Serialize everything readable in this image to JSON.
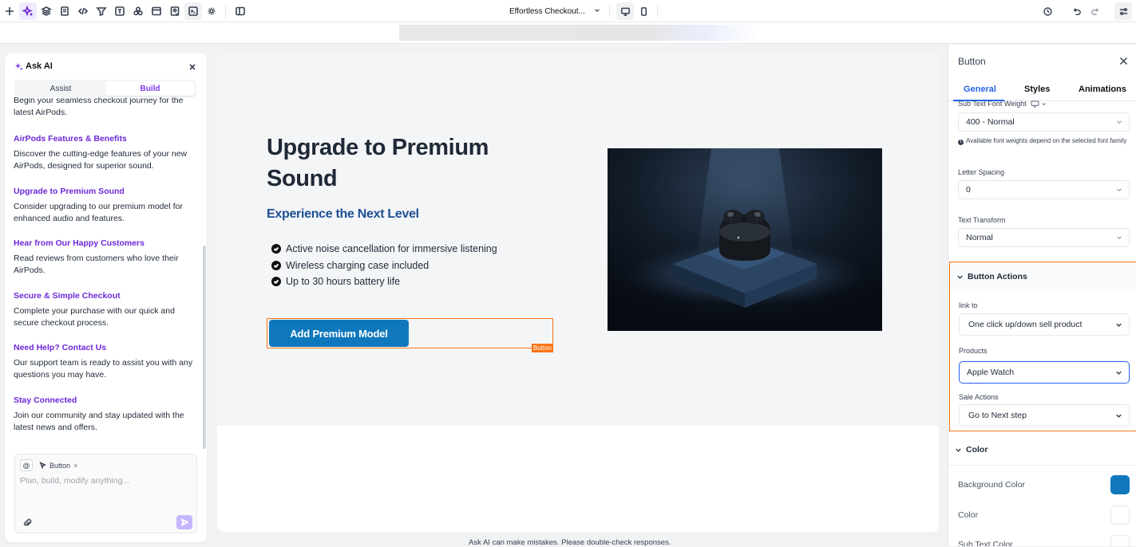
{
  "toolbar": {
    "page_select": "Effortless Checkout...",
    "icons": [
      "plus-icon",
      "ai-sparkle-icon",
      "layers-icon",
      "pages-icon",
      "code-icon",
      "funnel-icon",
      "template-icon",
      "components-icon",
      "layout-icon",
      "media-icon",
      "terminal-icon",
      "settings-cog-icon",
      "sidebar-toggle-icon"
    ]
  },
  "ai_panel": {
    "title": "Ask AI",
    "tabs": {
      "assist": "Assist",
      "build": "Build"
    },
    "clipped_text": "Begin your seamless checkout journey for the latest AirPods.",
    "items": [
      {
        "title": "AirPods Features & Benefits",
        "body": "Discover the cutting-edge features of your new AirPods, designed for superior sound."
      },
      {
        "title": "Upgrade to Premium Sound",
        "body": "Consider upgrading to our premium model for enhanced audio and features."
      },
      {
        "title": "Hear from Our Happy Customers",
        "body": "Read reviews from customers who love their AirPods."
      },
      {
        "title": "Secure & Simple Checkout",
        "body": "Complete your purchase with our quick and secure checkout process."
      },
      {
        "title": "Need Help? Contact Us",
        "body": "Our support team is ready to assist you with any questions you may have."
      },
      {
        "title": "Stay Connected",
        "body": "Join our community and stay updated with the latest news and offers."
      }
    ],
    "composer": {
      "at_symbol": "@",
      "chip_label": "Button",
      "chip_remove": "×",
      "placeholder": "Plan, build, modify anything..."
    }
  },
  "canvas": {
    "headline": "Upgrade to Premium Sound",
    "subheadline": "Experience the Next Level",
    "features": [
      "Active noise cancellation for immersive listening",
      "Wireless charging case included",
      "Up to 30 hours battery life"
    ],
    "cta_label": "Add Premium Model",
    "selection_tag": "Button",
    "footer_note": "Ask AI can make mistakes. Please double-check responses."
  },
  "right_panel": {
    "title": "Button",
    "tabs": [
      "General",
      "Styles",
      "Animations"
    ],
    "active_tab": "General",
    "sub_text_font_weight_label": "Sub Text Font Weight",
    "font_weight_value": "400 - Normal",
    "font_weight_note": "Available font weights depend on the selected font family",
    "letter_spacing_label": "Letter Spacing",
    "letter_spacing_value": "0",
    "text_transform_label": "Text Transform",
    "text_transform_value": "Normal",
    "button_actions": {
      "title": "Button Actions",
      "link_to_label": "link to",
      "link_to_value": "One click up/down sell product",
      "products_label": "Products",
      "products_value": "Apple Watch",
      "sale_actions_label": "Sale Actions",
      "sale_actions_value": "Go to Next step"
    },
    "color_section": {
      "title": "Color",
      "background_color_label": "Background Color",
      "background_color_value": "#0f78bd",
      "color_label": "Color",
      "color_value": "#ffffff",
      "sub_text_color_label": "Sub Text Color"
    }
  },
  "colors": {
    "accent_purple": "#6d28d9",
    "cta_blue": "#0f78bd",
    "selection_orange": "#f97316",
    "tab_blue": "#2563eb"
  }
}
